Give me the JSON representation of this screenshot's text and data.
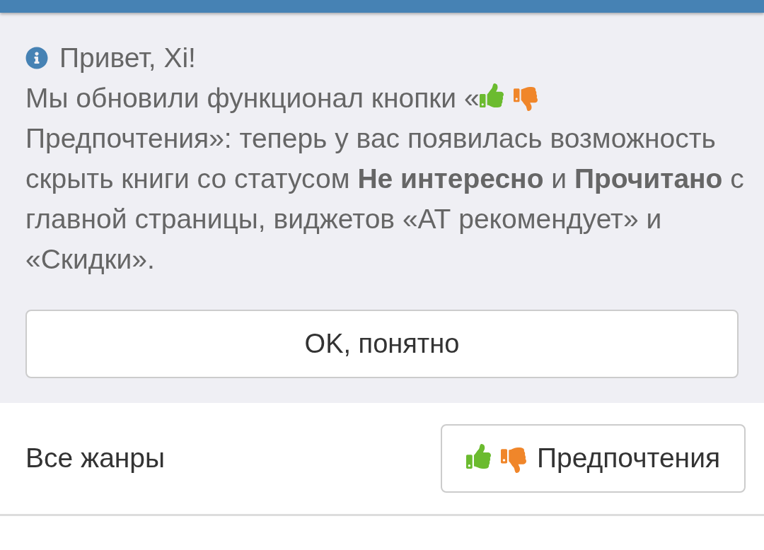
{
  "notice": {
    "greeting": "Привет, Xi!",
    "message_start": "Мы обновили функционал кнопки «",
    "message_end": "Предпочтения»: теперь у вас появилась возможность скрыть книги со статусом **Не интересно** и **Прочитано** с главной страницы, виджетов «АТ рекомендует» и «Скидки».",
    "button": "OK, понятно"
  },
  "filter_bar": {
    "genre": "Все жанры",
    "preferences_button": "Предпочтения"
  }
}
